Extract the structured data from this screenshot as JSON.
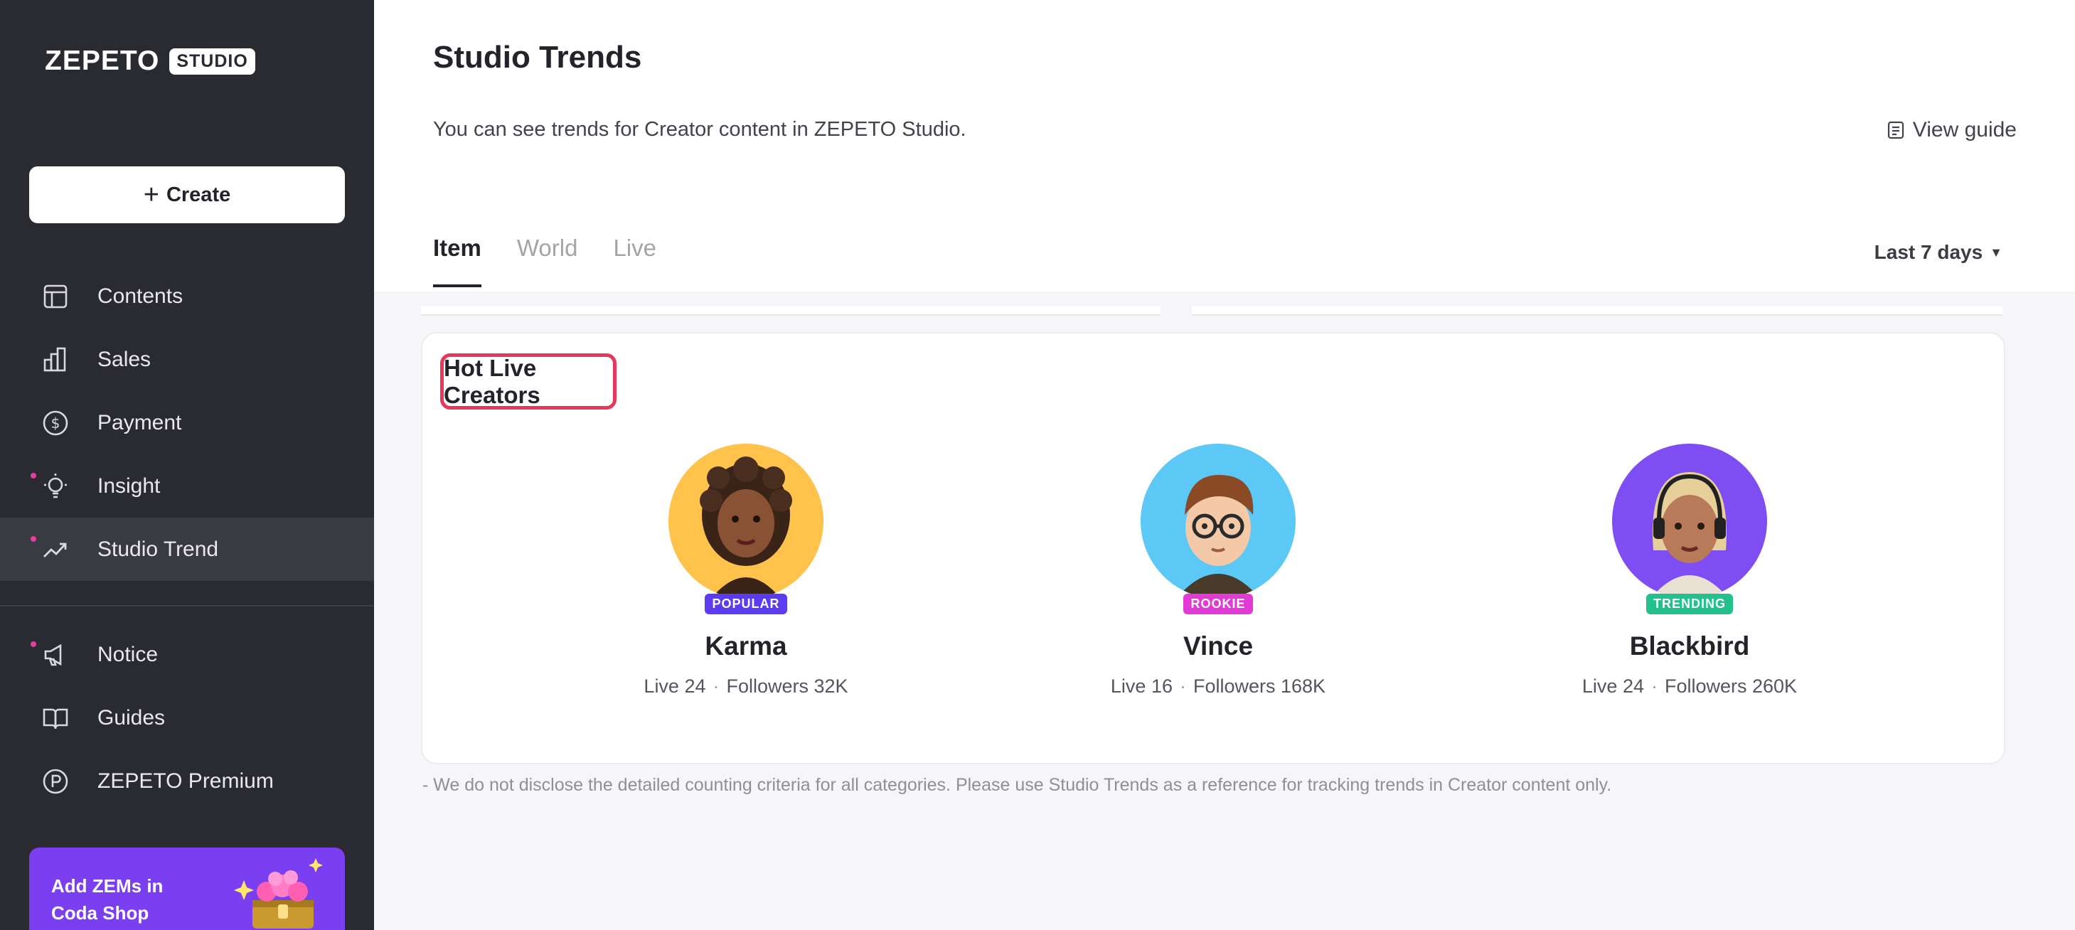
{
  "brand": {
    "word": "ZEPETO",
    "badge": "STUDIO"
  },
  "sidebar": {
    "create_label": "Create",
    "items": [
      {
        "label": "Contents",
        "icon": "layout-icon",
        "dot": false
      },
      {
        "label": "Sales",
        "icon": "bar-chart-icon",
        "dot": false
      },
      {
        "label": "Payment",
        "icon": "dollar-circle-icon",
        "dot": false
      },
      {
        "label": "Insight",
        "icon": "lightbulb-icon",
        "dot": true
      },
      {
        "label": "Studio Trend",
        "icon": "trend-up-icon",
        "dot": true,
        "active": true
      },
      {
        "label": "Notice",
        "icon": "megaphone-icon",
        "dot": true
      },
      {
        "label": "Guides",
        "icon": "book-icon",
        "dot": false
      },
      {
        "label": "ZEPETO Premium",
        "icon": "premium-circle-icon",
        "dot": false
      }
    ],
    "promo": {
      "line1": "Add ZEMs in",
      "line2": "Coda Shop"
    }
  },
  "page": {
    "title": "Studio Trends",
    "subtitle": "You can see trends for Creator content in ZEPETO Studio.",
    "guide_label": "View guide",
    "tabs": [
      "Item",
      "World",
      "Live"
    ],
    "active_tab": "Item",
    "period": "Last 7 days"
  },
  "section": {
    "title": "Hot Live Creators",
    "creators": [
      {
        "name": "Karma",
        "badge": "POPULAR",
        "badge_color": "#5b3cf0",
        "avatar_bg": "#ffc24b",
        "live": "Live 24",
        "followers": "Followers 32K"
      },
      {
        "name": "Vince",
        "badge": "ROOKIE",
        "badge_color": "#e23ad7",
        "avatar_bg": "#5cc8f5",
        "live": "Live 16",
        "followers": "Followers 168K"
      },
      {
        "name": "Blackbird",
        "badge": "TRENDING",
        "badge_color": "#22c08a",
        "avatar_bg": "#7e4ef2",
        "live": "Live 24",
        "followers": "Followers 260K"
      }
    ]
  },
  "footnote": "- We do not disclose the detailed counting criteria for all categories. Please use Studio Trends as a reference for tracking trends in Creator content only."
}
